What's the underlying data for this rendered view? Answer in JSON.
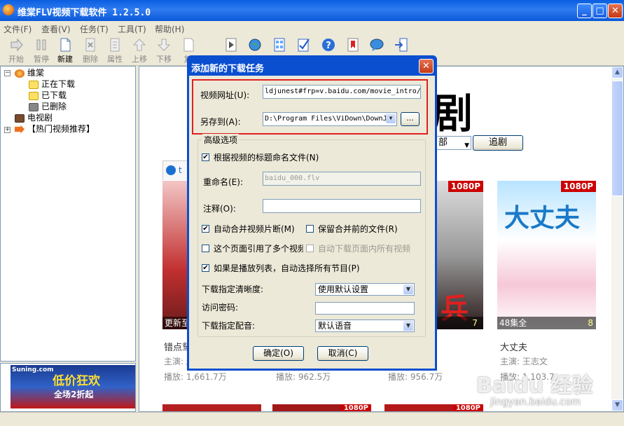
{
  "app": {
    "title": "维棠FLV视频下载软件 1.2.5.0"
  },
  "window_buttons": {
    "min": "_",
    "max": "□",
    "close": "✕"
  },
  "menu": [
    {
      "label": "文件(F)"
    },
    {
      "label": "查看(V)"
    },
    {
      "label": "任务(T)"
    },
    {
      "label": "工具(T)"
    },
    {
      "label": "帮助(H)"
    }
  ],
  "toolbar": {
    "start": "开始",
    "pause": "暂停",
    "new": "新建",
    "delete": "删除",
    "props": "属性",
    "up": "上移",
    "down": "下移",
    "copy": "复"
  },
  "tree": {
    "root": "维棠",
    "downloading": "正在下载",
    "downloaded": "已下载",
    "deleted": "已删除",
    "tv": "电视剧",
    "hot": "【热门视频推荐】"
  },
  "ad": {
    "logo": "Suning.com",
    "line1": "低价狂欢",
    "line2": "全场2折起"
  },
  "content": {
    "big_title_char": "剧",
    "select_value": "部",
    "chase_button": "追剧",
    "tab_label": "t",
    "cards": [
      {
        "caption": "更新至",
        "name": "错点鸳",
        "actor": "主演: 赵",
        "plays": "播放: 1,661.7万"
      },
      {
        "caption": "",
        "name": "",
        "actor": "",
        "plays": "播放: 962.5万"
      },
      {
        "caption": "",
        "badge": "1080P",
        "name": "",
        "actor": "",
        "plays": "播放: 956.7万",
        "num": "7"
      },
      {
        "caption": "48集全",
        "badge": "1080P",
        "name": "大丈夫",
        "actor": "主演: 王志文",
        "plays": "播放: 1,103.7",
        "num": "8"
      }
    ],
    "bottom_badges": [
      "1080P",
      "1080P"
    ]
  },
  "dialog": {
    "title": "添加新的下载任务",
    "url_label": "视频网址(U):",
    "url_value": "ldjunest#frp=v.baidu.com/movie_intro/",
    "saveto_label": "另存到(A):",
    "saveto_value": "D:\\Program Files\\ViDown\\DownJ",
    "browse": "...",
    "advanced": "高级选项",
    "name_by_title": "根据视频的标题命名文件(N)",
    "rename_label": "重命名(E):",
    "rename_value": "baidu_000.flv",
    "note_label": "注释(O):",
    "note_value": "",
    "auto_merge": "自动合并视频片断(M)",
    "keep_before_merge": "保留合并前的文件(R)",
    "multi_video": "这个页面引用了多个视频",
    "auto_download_all": "自动下载页面内所有视频",
    "playlist": "如果是播放列表，自动选择所有节目(P)",
    "clarity_label": "下载指定清晰度:",
    "clarity_value": "使用默认设置",
    "password_label": "访问密码:",
    "password_value": "",
    "dub_label": "下载指定配音:",
    "dub_value": "默认语音",
    "ok": "确定(O)",
    "cancel": "取消(C)"
  },
  "watermark": {
    "line1": "Baidu 经验",
    "line2": "jingyan.baidu.com"
  }
}
